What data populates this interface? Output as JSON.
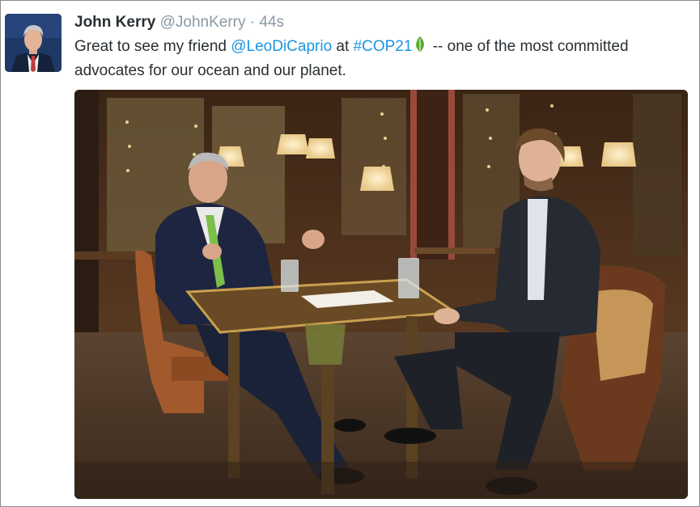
{
  "tweet": {
    "author_name": "John Kerry",
    "author_handle": "@JohnKerry",
    "separator": "·",
    "timestamp": "44s",
    "text_part1": "Great to see my friend ",
    "mention": "@LeoDiCaprio",
    "text_part2": " at ",
    "hashtag": "#COP21",
    "text_part3": " -- one of the most committed advocates for our ocean and our planet.",
    "hashtag_icon": "green-leaf-icon",
    "link_color": "#1b95e0",
    "secondary_color": "#8899a6"
  }
}
